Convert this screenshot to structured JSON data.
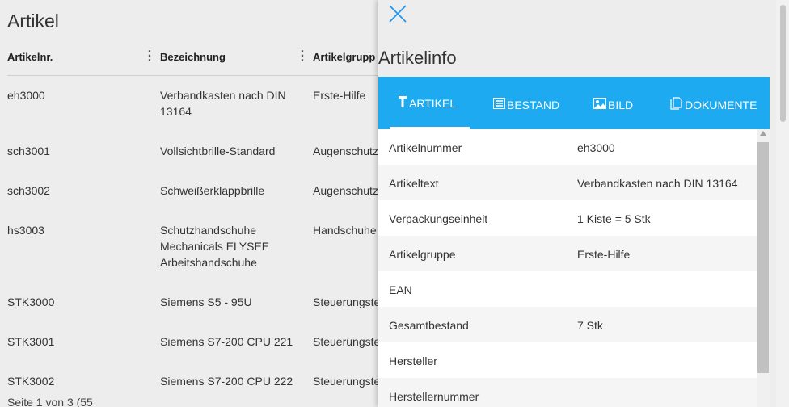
{
  "list": {
    "title": "Artikel",
    "columns": [
      "Artikelnr.",
      "Bezeichnung",
      "Artikelgrupp"
    ],
    "rows": [
      {
        "nr": "eh3000",
        "bez": "Verbandkasten nach DIN 13164",
        "grp": "Erste-Hilfe"
      },
      {
        "nr": "sch3001",
        "bez": "Vollsichtbrille-Standard",
        "grp": "Augenschutz"
      },
      {
        "nr": "sch3002",
        "bez": "Schweißerklappbrille",
        "grp": "Augenschutz"
      },
      {
        "nr": "hs3003",
        "bez": "Schutzhandschuhe Mechanicals ELYSEE Arbeitshandschuhe",
        "grp": "Handschuhe"
      },
      {
        "nr": "STK3000",
        "bez": "Siemens S5 - 95U",
        "grp": "Steuerungste"
      },
      {
        "nr": "STK3001",
        "bez": "Siemens S7-200 CPU 221",
        "grp": "Steuerungste"
      },
      {
        "nr": "STK3002",
        "bez": "Siemens S7-200 CPU 222",
        "grp": "Steuerungste"
      }
    ],
    "footer": "Seite 1 von 3 (55"
  },
  "panel": {
    "title": "Artikelinfo",
    "tabs": [
      {
        "label": "ARTIKEL",
        "icon": "wrench-icon"
      },
      {
        "label": "BESTAND",
        "icon": "list-icon"
      },
      {
        "label": "BILD",
        "icon": "image-icon"
      },
      {
        "label": "DOKUMENTE",
        "icon": "documents-icon"
      }
    ],
    "active_tab": "ARTIKEL",
    "fields": [
      {
        "label": "Artikelnummer",
        "value": "eh3000"
      },
      {
        "label": "Artikeltext",
        "value": "Verbandkasten nach DIN 13164"
      },
      {
        "label": "Verpackungseinheit",
        "value": "1 Kiste = 5 Stk"
      },
      {
        "label": "Artikelgruppe",
        "value": "Erste-Hilfe"
      },
      {
        "label": "EAN",
        "value": ""
      },
      {
        "label": "Gesamtbestand",
        "value": "7 Stk"
      },
      {
        "label": "Hersteller",
        "value": ""
      },
      {
        "label": "Herstellernummer",
        "value": ""
      }
    ]
  },
  "colors": {
    "accent": "#1eaaf1",
    "close_icon": "#2196f3"
  }
}
